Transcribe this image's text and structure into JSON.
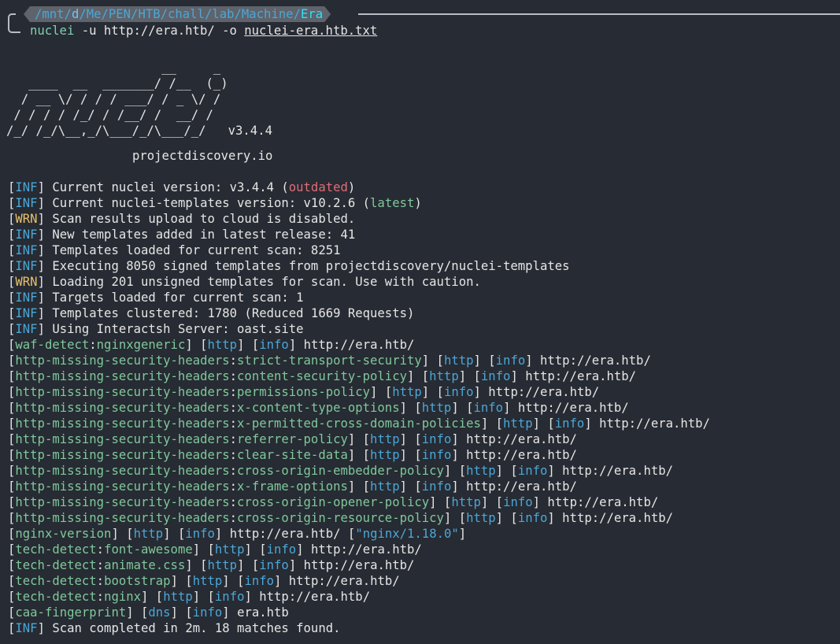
{
  "prompt": {
    "path_prefix": "/mnt/",
    "path_d": "d",
    "path_mid": "/Me/PEN/HTB/chall/lab/Machine/",
    "path_end": "Era",
    "command_exe": "nuclei",
    "command_args": " -u http://era.htb/ -o ",
    "command_outfile": "nuclei-era.htb.txt"
  },
  "banner": {
    "ascii": "                     __     _\n   ____  __  _______/ /__  (_)\n  / __ \\/ / / / ___/ / _ \\/ /\n / / / / /_/ / /__/ /  __/ /\n/_/ /_/\\__,_/\\___/_/\\___/_/   v3.4.4",
    "site": "projectdiscovery.io"
  },
  "output": [
    [
      [
        "t",
        "["
      ],
      [
        "b",
        "INF"
      ],
      [
        "t",
        "] Current nuclei version: v3.4.4 ("
      ],
      [
        "r",
        "outdated"
      ],
      [
        "t",
        ")"
      ]
    ],
    [
      [
        "t",
        "["
      ],
      [
        "b",
        "INF"
      ],
      [
        "t",
        "] Current nuclei-templates version: v10.2.6 ("
      ],
      [
        "g",
        "latest"
      ],
      [
        "t",
        ")"
      ]
    ],
    [
      [
        "t",
        "["
      ],
      [
        "y",
        "WRN"
      ],
      [
        "t",
        "] Scan results upload to cloud is disabled."
      ]
    ],
    [
      [
        "t",
        "["
      ],
      [
        "b",
        "INF"
      ],
      [
        "t",
        "] New templates added in latest release: 41"
      ]
    ],
    [
      [
        "t",
        "["
      ],
      [
        "b",
        "INF"
      ],
      [
        "t",
        "] Templates loaded for current scan: 8251"
      ]
    ],
    [
      [
        "t",
        "["
      ],
      [
        "b",
        "INF"
      ],
      [
        "t",
        "] Executing 8050 signed templates from projectdiscovery/nuclei-templates"
      ]
    ],
    [
      [
        "t",
        "["
      ],
      [
        "y",
        "WRN"
      ],
      [
        "t",
        "] Loading 201 unsigned templates for scan. Use with caution."
      ]
    ],
    [
      [
        "t",
        "["
      ],
      [
        "b",
        "INF"
      ],
      [
        "t",
        "] Targets loaded for current scan: 1"
      ]
    ],
    [
      [
        "t",
        "["
      ],
      [
        "b",
        "INF"
      ],
      [
        "t",
        "] Templates clustered: 1780 (Reduced 1669 Requests)"
      ]
    ],
    [
      [
        "t",
        "["
      ],
      [
        "b",
        "INF"
      ],
      [
        "t",
        "] Using Interactsh Server: oast.site"
      ]
    ],
    [
      [
        "t",
        "["
      ],
      [
        "g",
        "waf-detect"
      ],
      [
        "t",
        ":"
      ],
      [
        "g",
        "nginxgeneric"
      ],
      [
        "t",
        "] ["
      ],
      [
        "b",
        "http"
      ],
      [
        "t",
        "] ["
      ],
      [
        "b",
        "info"
      ],
      [
        "t",
        "] http://era.htb/"
      ]
    ],
    [
      [
        "t",
        "["
      ],
      [
        "g",
        "http-missing-security-headers"
      ],
      [
        "t",
        ":"
      ],
      [
        "g",
        "strict-transport-security"
      ],
      [
        "t",
        "] ["
      ],
      [
        "b",
        "http"
      ],
      [
        "t",
        "] ["
      ],
      [
        "b",
        "info"
      ],
      [
        "t",
        "] http://era.htb/"
      ]
    ],
    [
      [
        "t",
        "["
      ],
      [
        "g",
        "http-missing-security-headers"
      ],
      [
        "t",
        ":"
      ],
      [
        "g",
        "content-security-policy"
      ],
      [
        "t",
        "] ["
      ],
      [
        "b",
        "http"
      ],
      [
        "t",
        "] ["
      ],
      [
        "b",
        "info"
      ],
      [
        "t",
        "] http://era.htb/"
      ]
    ],
    [
      [
        "t",
        "["
      ],
      [
        "g",
        "http-missing-security-headers"
      ],
      [
        "t",
        ":"
      ],
      [
        "g",
        "permissions-policy"
      ],
      [
        "t",
        "] ["
      ],
      [
        "b",
        "http"
      ],
      [
        "t",
        "] ["
      ],
      [
        "b",
        "info"
      ],
      [
        "t",
        "] http://era.htb/"
      ]
    ],
    [
      [
        "t",
        "["
      ],
      [
        "g",
        "http-missing-security-headers"
      ],
      [
        "t",
        ":"
      ],
      [
        "g",
        "x-content-type-options"
      ],
      [
        "t",
        "] ["
      ],
      [
        "b",
        "http"
      ],
      [
        "t",
        "] ["
      ],
      [
        "b",
        "info"
      ],
      [
        "t",
        "] http://era.htb/"
      ]
    ],
    [
      [
        "t",
        "["
      ],
      [
        "g",
        "http-missing-security-headers"
      ],
      [
        "t",
        ":"
      ],
      [
        "g",
        "x-permitted-cross-domain-policies"
      ],
      [
        "t",
        "] ["
      ],
      [
        "b",
        "http"
      ],
      [
        "t",
        "] ["
      ],
      [
        "b",
        "info"
      ],
      [
        "t",
        "] http://era.htb/"
      ]
    ],
    [
      [
        "t",
        "["
      ],
      [
        "g",
        "http-missing-security-headers"
      ],
      [
        "t",
        ":"
      ],
      [
        "g",
        "referrer-policy"
      ],
      [
        "t",
        "] ["
      ],
      [
        "b",
        "http"
      ],
      [
        "t",
        "] ["
      ],
      [
        "b",
        "info"
      ],
      [
        "t",
        "] http://era.htb/"
      ]
    ],
    [
      [
        "t",
        "["
      ],
      [
        "g",
        "http-missing-security-headers"
      ],
      [
        "t",
        ":"
      ],
      [
        "g",
        "clear-site-data"
      ],
      [
        "t",
        "] ["
      ],
      [
        "b",
        "http"
      ],
      [
        "t",
        "] ["
      ],
      [
        "b",
        "info"
      ],
      [
        "t",
        "] http://era.htb/"
      ]
    ],
    [
      [
        "t",
        "["
      ],
      [
        "g",
        "http-missing-security-headers"
      ],
      [
        "t",
        ":"
      ],
      [
        "g",
        "cross-origin-embedder-policy"
      ],
      [
        "t",
        "] ["
      ],
      [
        "b",
        "http"
      ],
      [
        "t",
        "] ["
      ],
      [
        "b",
        "info"
      ],
      [
        "t",
        "] http://era.htb/"
      ]
    ],
    [
      [
        "t",
        "["
      ],
      [
        "g",
        "http-missing-security-headers"
      ],
      [
        "t",
        ":"
      ],
      [
        "g",
        "x-frame-options"
      ],
      [
        "t",
        "] ["
      ],
      [
        "b",
        "http"
      ],
      [
        "t",
        "] ["
      ],
      [
        "b",
        "info"
      ],
      [
        "t",
        "] http://era.htb/"
      ]
    ],
    [
      [
        "t",
        "["
      ],
      [
        "g",
        "http-missing-security-headers"
      ],
      [
        "t",
        ":"
      ],
      [
        "g",
        "cross-origin-opener-policy"
      ],
      [
        "t",
        "] ["
      ],
      [
        "b",
        "http"
      ],
      [
        "t",
        "] ["
      ],
      [
        "b",
        "info"
      ],
      [
        "t",
        "] http://era.htb/"
      ]
    ],
    [
      [
        "t",
        "["
      ],
      [
        "g",
        "http-missing-security-headers"
      ],
      [
        "t",
        ":"
      ],
      [
        "g",
        "cross-origin-resource-policy"
      ],
      [
        "t",
        "] ["
      ],
      [
        "b",
        "http"
      ],
      [
        "t",
        "] ["
      ],
      [
        "b",
        "info"
      ],
      [
        "t",
        "] http://era.htb/"
      ]
    ],
    [
      [
        "t",
        "["
      ],
      [
        "g",
        "nginx-version"
      ],
      [
        "t",
        "] ["
      ],
      [
        "b",
        "http"
      ],
      [
        "t",
        "] ["
      ],
      [
        "b",
        "info"
      ],
      [
        "t",
        "] http://era.htb/ ["
      ],
      [
        "b",
        "\"nginx/1.18.0\""
      ],
      [
        "t",
        "]"
      ]
    ],
    [
      [
        "t",
        "["
      ],
      [
        "g",
        "tech-detect"
      ],
      [
        "t",
        ":"
      ],
      [
        "g",
        "font-awesome"
      ],
      [
        "t",
        "] ["
      ],
      [
        "b",
        "http"
      ],
      [
        "t",
        "] ["
      ],
      [
        "b",
        "info"
      ],
      [
        "t",
        "] http://era.htb/"
      ]
    ],
    [
      [
        "t",
        "["
      ],
      [
        "g",
        "tech-detect"
      ],
      [
        "t",
        ":"
      ],
      [
        "g",
        "animate.css"
      ],
      [
        "t",
        "] ["
      ],
      [
        "b",
        "http"
      ],
      [
        "t",
        "] ["
      ],
      [
        "b",
        "info"
      ],
      [
        "t",
        "] http://era.htb/"
      ]
    ],
    [
      [
        "t",
        "["
      ],
      [
        "g",
        "tech-detect"
      ],
      [
        "t",
        ":"
      ],
      [
        "g",
        "bootstrap"
      ],
      [
        "t",
        "] ["
      ],
      [
        "b",
        "http"
      ],
      [
        "t",
        "] ["
      ],
      [
        "b",
        "info"
      ],
      [
        "t",
        "] http://era.htb/"
      ]
    ],
    [
      [
        "t",
        "["
      ],
      [
        "g",
        "tech-detect"
      ],
      [
        "t",
        ":"
      ],
      [
        "g",
        "nginx"
      ],
      [
        "t",
        "] ["
      ],
      [
        "b",
        "http"
      ],
      [
        "t",
        "] ["
      ],
      [
        "b",
        "info"
      ],
      [
        "t",
        "] http://era.htb/"
      ]
    ],
    [
      [
        "t",
        "["
      ],
      [
        "g",
        "caa-fingerprint"
      ],
      [
        "t",
        "] ["
      ],
      [
        "b",
        "dns"
      ],
      [
        "t",
        "] ["
      ],
      [
        "b",
        "info"
      ],
      [
        "t",
        "] era.htb"
      ]
    ],
    [
      [
        "t",
        "["
      ],
      [
        "b",
        "INF"
      ],
      [
        "t",
        "] Scan completed in 2m. 18 matches found."
      ]
    ]
  ]
}
